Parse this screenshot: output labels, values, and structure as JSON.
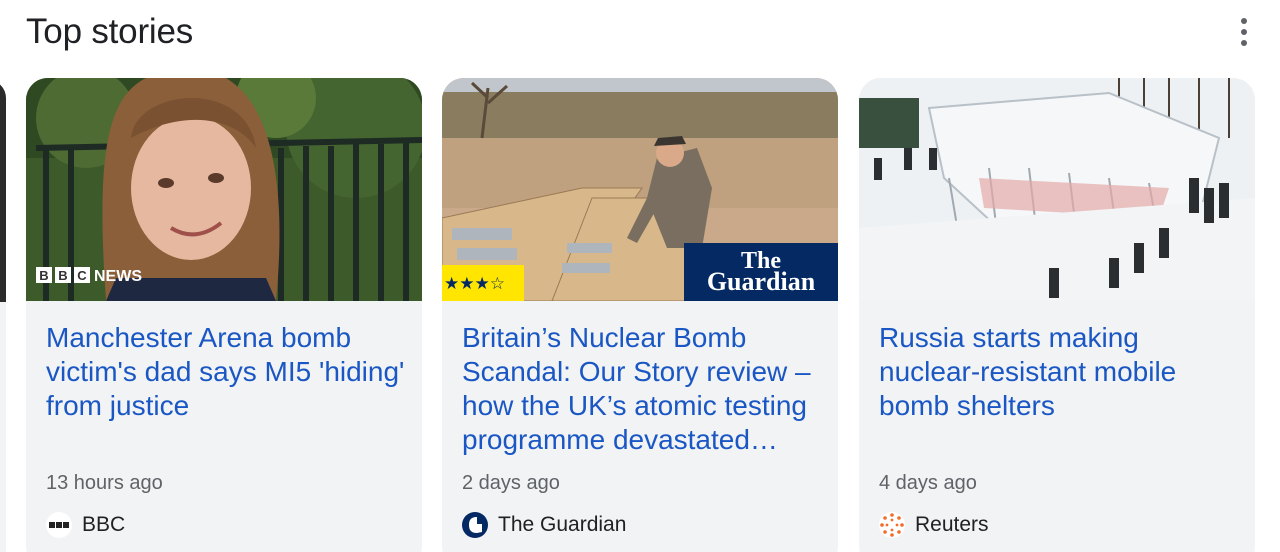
{
  "section": {
    "title": "Top stories"
  },
  "stories": [
    {
      "headline": "Manchester Arena bomb victim's dad says MI5 'hiding' from justice",
      "time": "13 hours ago",
      "source": "BBC",
      "image_overlay": "NEWS",
      "source_icon": "bbc-logo-icon"
    },
    {
      "headline": "Britain’s Nuclear Bomb Scandal: Our Story review – how the UK’s atomic testing programme devastated…",
      "time": "2 days ago",
      "source": "The Guardian",
      "image_overlay_line1": "The",
      "image_overlay_line2": "Guardian",
      "rating": "★★★☆",
      "source_icon": "guardian-logo-icon"
    },
    {
      "headline": "Russia starts making nuclear-resistant mobile bomb shelters",
      "time": "4 days ago",
      "source": "Reuters",
      "source_icon": "reuters-logo-icon"
    }
  ],
  "colors": {
    "headline": "#1a57c4",
    "card_bg": "#f1f3f4",
    "guardian_blue": "#052962",
    "rating_yellow": "#ffe500"
  }
}
